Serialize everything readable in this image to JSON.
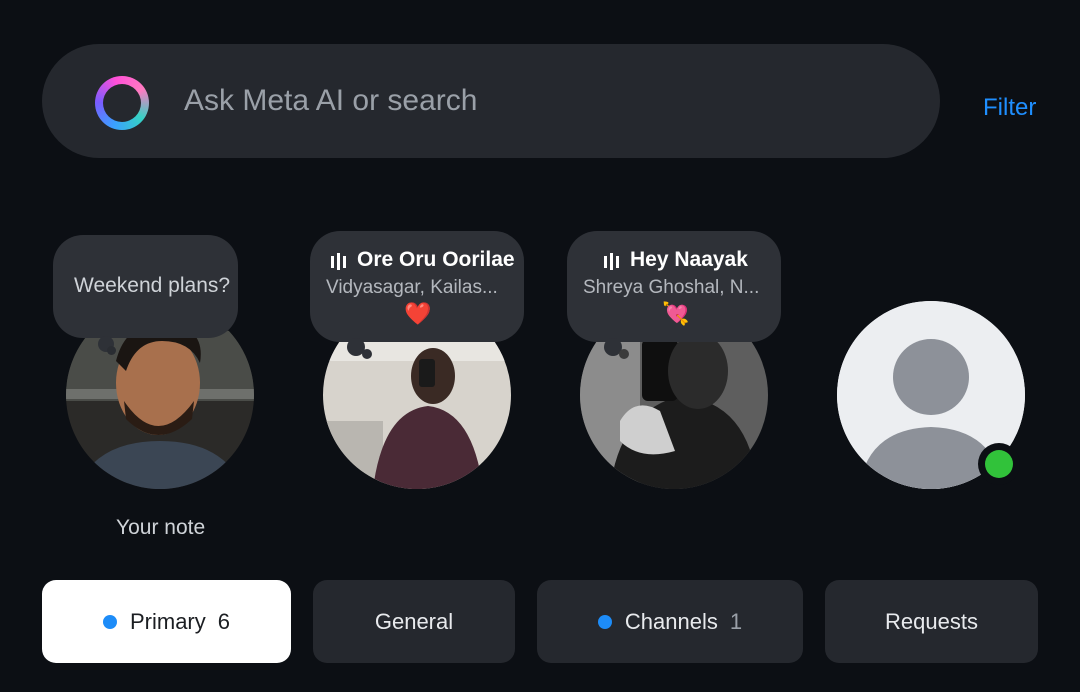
{
  "search": {
    "placeholder": "Ask Meta AI or search",
    "icon": "meta-ai-ring-icon"
  },
  "filter_label": "Filter",
  "notes": [
    {
      "kind": "text",
      "note": "Weekend plans?",
      "caption": "Your note"
    },
    {
      "kind": "music",
      "song": "Ore Oru Oorilae",
      "artist": "Vidyasagar, Kailas...",
      "emoji": "❤️"
    },
    {
      "kind": "music",
      "song": "Hey Naayak",
      "artist": "Shreya Ghoshal, N...",
      "emoji": "💘"
    },
    {
      "kind": "contact",
      "online": true
    }
  ],
  "tabs": [
    {
      "label": "Primary",
      "count": "6",
      "unread_dot": true,
      "active": true
    },
    {
      "label": "General",
      "count": "",
      "unread_dot": false,
      "active": false
    },
    {
      "label": "Channels",
      "count": "1",
      "unread_dot": true,
      "active": false
    },
    {
      "label": "Requests",
      "count": "",
      "unread_dot": false,
      "active": false
    }
  ],
  "colors": {
    "accent": "#1f8fff",
    "online": "#31c23a",
    "background": "#0c0f14"
  }
}
